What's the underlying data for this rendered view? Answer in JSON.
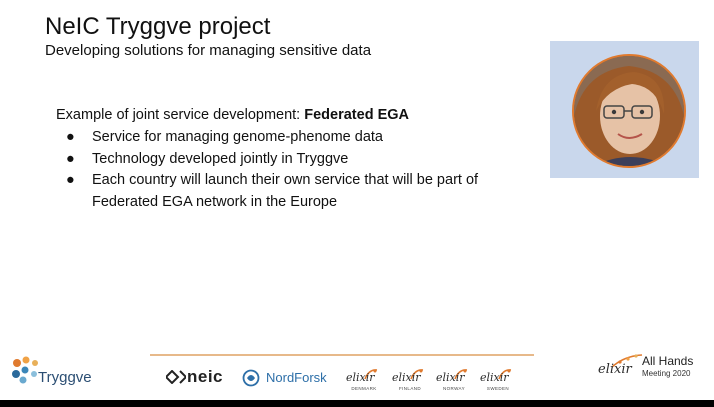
{
  "slide": {
    "title": "NeIC Tryggve project",
    "subtitle": "Developing solutions for managing sensitive data",
    "intro_prefix": "Example of joint service development: ",
    "intro_bold": "Federated EGA",
    "bullets": [
      "Service for managing genome-phenome data",
      "Technology developed jointly in Tryggve",
      "Each country will launch their own service that will be part of Federated EGA network in the Europe"
    ],
    "bullet_glyph": "●"
  },
  "photo": {
    "description_icon": "presenter-portrait",
    "bg_color": "#c9d7ec",
    "ring_color": "#e07a2e"
  },
  "footer": {
    "tryggve_label": "Tryggve",
    "neic_label": "neic",
    "nordforsk_label": "NordForsk",
    "elixir_nodes": [
      {
        "word": "elixir",
        "country": "DENMARK"
      },
      {
        "word": "elixir",
        "country": "FINLAND"
      },
      {
        "word": "elixir",
        "country": "NORWAY"
      },
      {
        "word": "elixir",
        "country": "SWEDEN"
      }
    ],
    "allhands_word": "elixir",
    "allhands_title": "All Hands",
    "allhands_subtitle": "Meeting 2020",
    "accent_orange": "#e07a2e",
    "divider_color": "#e7b98a"
  }
}
